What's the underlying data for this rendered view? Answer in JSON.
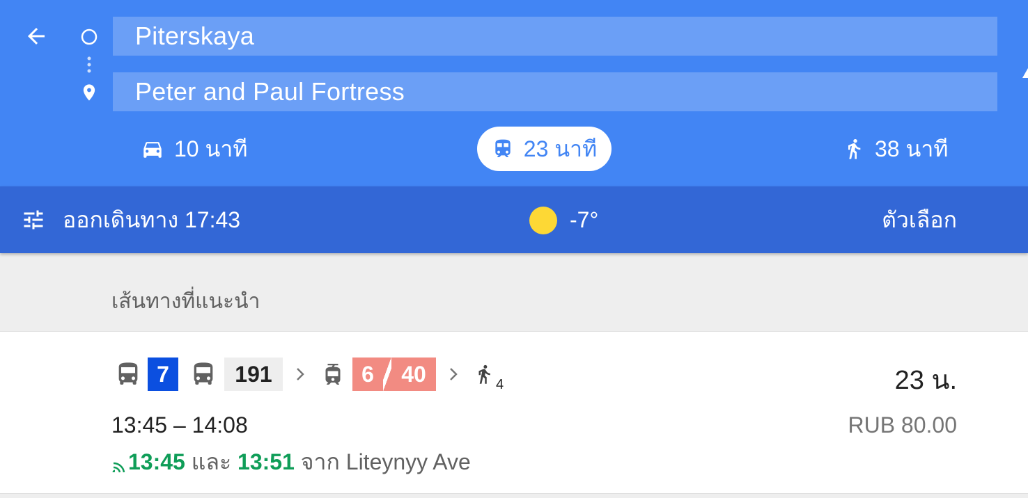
{
  "header": {
    "origin": "Piterskaya",
    "destination": "Peter and Paul Fortress",
    "modes": [
      {
        "icon": "car-icon",
        "label": "10 นาที"
      },
      {
        "icon": "transit-icon",
        "label": "23 นาที",
        "selected": true
      },
      {
        "icon": "walk-icon",
        "label": "38 นาที"
      }
    ]
  },
  "options_bar": {
    "depart": "ออกเดินทาง 17:43",
    "weather_icon": "sun-icon",
    "temperature": "-7°",
    "options_label": "ตัวเลือก"
  },
  "section": {
    "title": "เส้นทางที่แนะนำ"
  },
  "route": {
    "lines": {
      "bus1": "7",
      "bus2": "191",
      "tram_a": "6",
      "tram_b": "40",
      "walk_minutes": "4"
    },
    "duration": "23 น.",
    "times": "13:45 – 14:08",
    "fare": "RUB 80.00",
    "realtime": {
      "t1": "13:45",
      "and": "และ",
      "t2": "13:51",
      "from": "จาก Liteynyy Ave"
    }
  },
  "colors": {
    "header": "#4285f4",
    "options_bar": "#3367d6",
    "bus7": "#0b4fe0",
    "tram": "#f28b82",
    "realtime_green": "#0f9d58"
  }
}
